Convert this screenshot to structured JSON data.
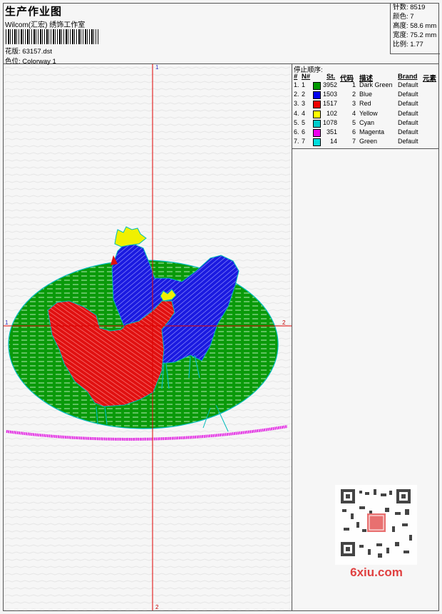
{
  "header": {
    "title": "生产作业图",
    "company": "Wilcom(汇宏) 绣饰工作室",
    "design_label": "花版:",
    "design_file": "63157.dst",
    "colorway_label": "色位:",
    "colorway": "Colorway 1"
  },
  "stats": {
    "stitches": "针数: 8519",
    "colors": "颜色: 7",
    "height": "高度: 58.6 mm",
    "width": "宽度: 75.2 mm",
    "ratio": "比例: 1.77"
  },
  "stop_sequence": {
    "title": "停止顺序:",
    "headers": [
      "#",
      "N#",
      "St.",
      "代码",
      "描述",
      "Brand",
      "元素"
    ],
    "rows": [
      {
        "num": "1.",
        "n": "1",
        "color": "#009900",
        "stitches": "3952",
        "code": "1",
        "desc": "Dark Green",
        "brand": "Default"
      },
      {
        "num": "2.",
        "n": "2",
        "color": "#0000ee",
        "stitches": "1503",
        "code": "2",
        "desc": "Blue",
        "brand": "Default"
      },
      {
        "num": "3.",
        "n": "3",
        "color": "#ee0000",
        "stitches": "1517",
        "code": "3",
        "desc": "Red",
        "brand": "Default"
      },
      {
        "num": "4.",
        "n": "4",
        "color": "#ffff00",
        "stitches": "102",
        "code": "4",
        "desc": "Yellow",
        "brand": "Default"
      },
      {
        "num": "5.",
        "n": "5",
        "color": "#00cccc",
        "stitches": "1078",
        "code": "5",
        "desc": "Cyan",
        "brand": "Default"
      },
      {
        "num": "6.",
        "n": "6",
        "color": "#ee00ee",
        "stitches": "351",
        "code": "6",
        "desc": "Magenta",
        "brand": "Default"
      },
      {
        "num": "7.",
        "n": "7",
        "color": "#00dddd",
        "stitches": "14",
        "code": "7",
        "desc": "Green",
        "brand": "Default"
      }
    ]
  },
  "crosshair": {
    "top": "1",
    "bottom": "2",
    "left": "1",
    "right": "2"
  },
  "watermark": {
    "site": "6xiu.com"
  }
}
